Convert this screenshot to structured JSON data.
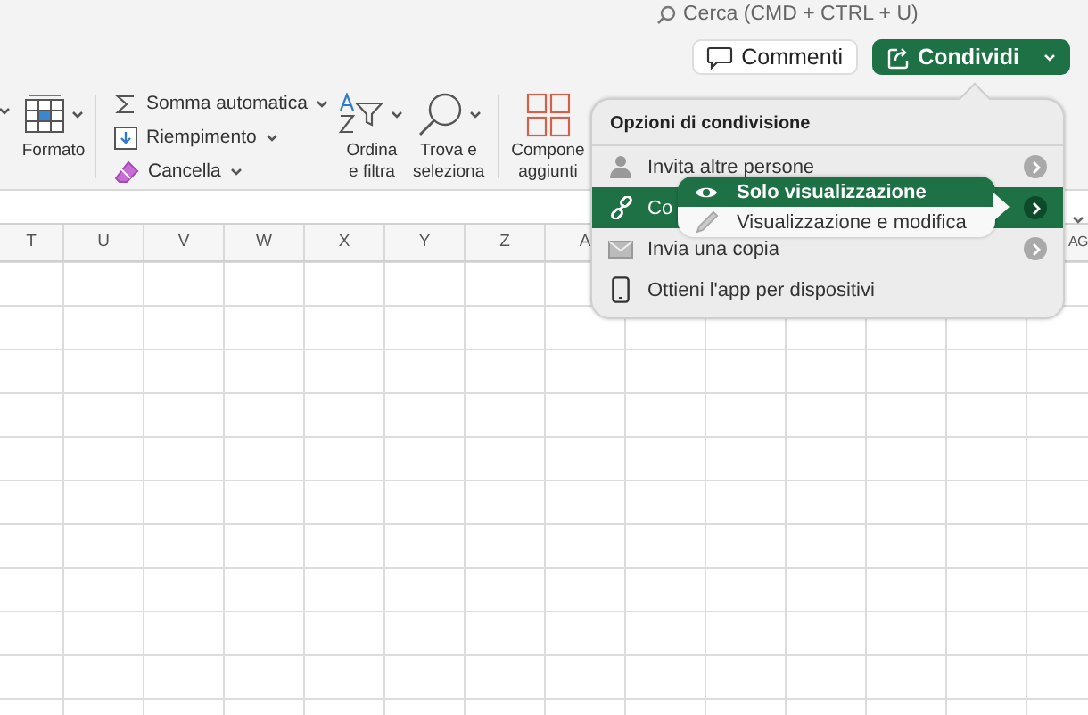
{
  "search": {
    "placeholder": "Cerca (CMD + CTRL + U)"
  },
  "top_buttons": [
    {
      "kind": "comments",
      "label": "Commenti"
    },
    {
      "kind": "share",
      "label": "Condividi"
    }
  ],
  "ribbon": {
    "format": {
      "label": "Formato"
    },
    "edit_commands": [
      {
        "kind": "sum",
        "label": "Somma automatica"
      },
      {
        "kind": "fill",
        "label": "Riempimento"
      },
      {
        "kind": "clear",
        "label": "Cancella"
      }
    ],
    "large_buttons": [
      {
        "kind": "sort",
        "lines": [
          "Ordina",
          "e filtra"
        ]
      },
      {
        "kind": "find",
        "lines": [
          "Trova e",
          "seleziona"
        ]
      },
      {
        "kind": "addins",
        "lines": [
          "Compone",
          "aggiunti"
        ]
      }
    ]
  },
  "sheet": {
    "column_headers": [
      "T",
      "U",
      "V",
      "W",
      "X",
      "Y",
      "Z",
      "A"
    ],
    "last_column_header": "AG"
  },
  "share_menu": {
    "title": "Opzioni di condivisione",
    "items": [
      {
        "kind": "person",
        "label": "Invita altre persone",
        "selected": false,
        "submenu": true
      },
      {
        "kind": "link",
        "label": "Co",
        "selected": true,
        "submenu": true
      },
      {
        "kind": "mail",
        "label": "Invia una copia",
        "selected": false,
        "submenu": true
      },
      {
        "kind": "phone",
        "label": "Ottieni l'app per dispositivi",
        "selected": false,
        "submenu": false
      }
    ],
    "submenu": [
      {
        "kind": "view",
        "label": "Solo visualizzazione",
        "selected": true
      },
      {
        "kind": "edit",
        "label": "Visualizzazione e modifica",
        "selected": false
      }
    ]
  }
}
